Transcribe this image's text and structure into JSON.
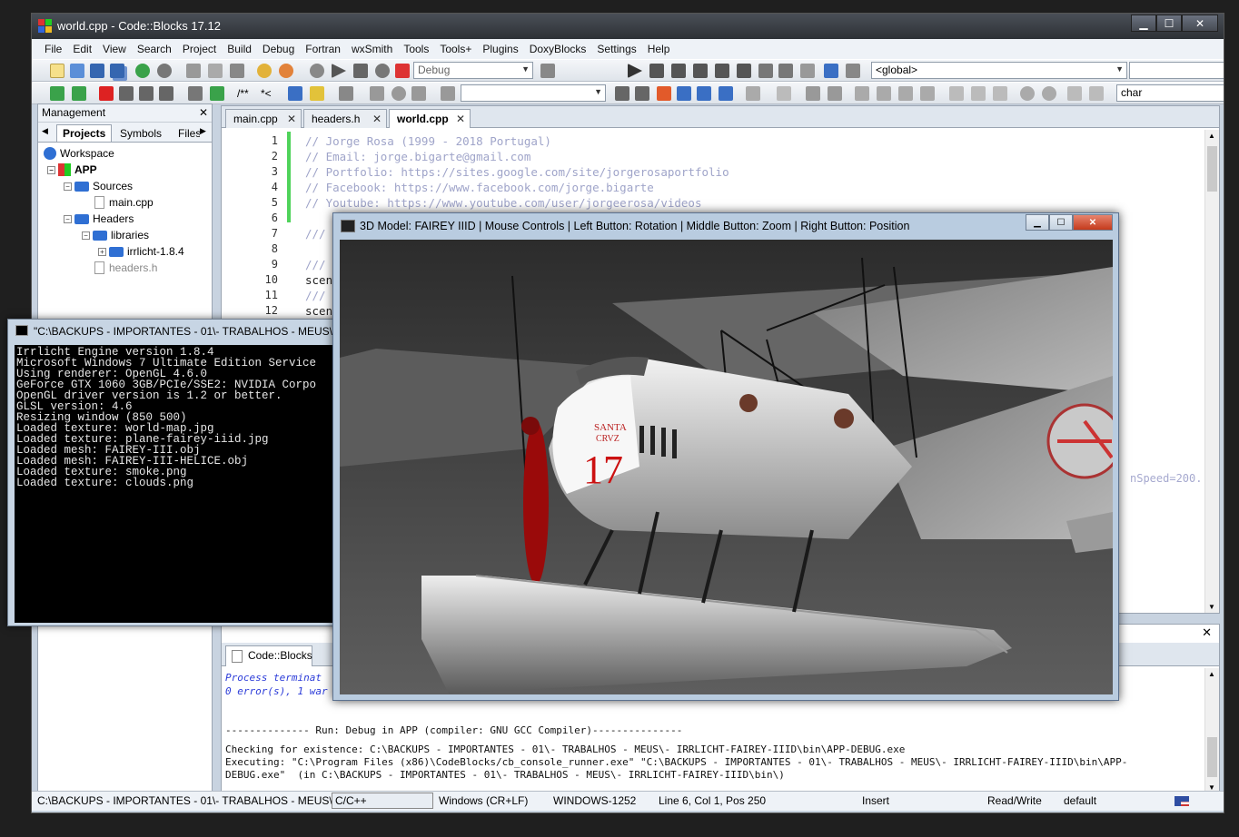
{
  "window": {
    "title": "world.cpp - Code::Blocks 17.12",
    "buttons": {
      "min": "▁",
      "max": "☐",
      "close": "✕"
    }
  },
  "menu": [
    "File",
    "Edit",
    "View",
    "Search",
    "Project",
    "Build",
    "Debug",
    "Fortran",
    "wxSmith",
    "Tools",
    "Tools+",
    "Plugins",
    "DoxyBlocks",
    "Settings",
    "Help"
  ],
  "toolbar": {
    "build_target": "Debug",
    "scope": "<global>",
    "search_text": "char",
    "doxy_labels": [
      "/**",
      "*<"
    ]
  },
  "management": {
    "title": "Management",
    "tabs": [
      "Projects",
      "Symbols",
      "Files"
    ],
    "tree": {
      "workspace": "Workspace",
      "project": "APP",
      "sources": "Sources",
      "main": "main.cpp",
      "headers": "Headers",
      "libraries": "libraries",
      "irrlicht": "irrlicht-1.8.4",
      "headers_file": "headers.h"
    }
  },
  "editor": {
    "tabs": [
      "main.cpp",
      "headers.h",
      "world.cpp"
    ],
    "active_tab": "world.cpp",
    "lines": [
      "1",
      "2",
      "3",
      "4",
      "5",
      "6",
      "7",
      "8",
      "9",
      "10",
      "11",
      "12"
    ],
    "code": [
      "// Jorge Rosa (1999 - 2018 Portugal)",
      "// Email: jorge.bigarte@gmail.com",
      "// Portfolio: https://sites.google.com/site/jorgerosaportfolio",
      "// Facebook: https://www.facebook.com/jorge.bigarte",
      "// Youtube: https://www.youtube.com/user/jorgeerosa/videos",
      "",
      "///",
      "",
      "///",
      "scen",
      "///",
      "scen"
    ],
    "right_fragment": "nSpeed=200."
  },
  "log": {
    "tab": "Code::Blocks",
    "lines": [
      "Process terminat",
      "0 error(s), 1 war",
      "",
      "-------------- Run: Debug in APP (compiler: GNU GCC Compiler)---------------",
      "",
      "Checking for existence: C:\\BACKUPS - IMPORTANTES - 01\\- TRABALHOS - MEUS\\- IRRLICHT-FAIREY-IIID\\bin\\APP-DEBUG.exe",
      "Executing: \"C:\\Program Files (x86)\\CodeBlocks/cb_console_runner.exe\" \"C:\\BACKUPS - IMPORTANTES - 01\\- TRABALHOS - MEUS\\- IRRLICHT-FAIREY-IIID\\bin\\APP-",
      "DEBUG.exe\"  (in C:\\BACKUPS - IMPORTANTES - 01\\- TRABALHOS - MEUS\\- IRRLICHT-FAIREY-IIID\\bin\\)"
    ]
  },
  "status": {
    "path": "C:\\BACKUPS - IMPORTANTES - 01\\- TRABALHOS - MEUS\\- IR",
    "lang": "C/C++",
    "eol": "Windows (CR+LF)",
    "encoding": "WINDOWS-1252",
    "position": "Line 6, Col 1, Pos 250",
    "mode": "Insert",
    "access": "Read/Write",
    "profile": "default"
  },
  "console": {
    "title": "\"C:\\BACKUPS - IMPORTANTES - 01\\- TRABALHOS - MEUS\\- IRR",
    "lines": [
      "Irrlicht Engine version 1.8.4",
      "Microsoft Windows 7 Ultimate Edition Service",
      "Using renderer: OpenGL 4.6.0",
      "GeForce GTX 1060 3GB/PCIe/SSE2: NVIDIA Corpo",
      "OpenGL driver version is 1.2 or better.",
      "GLSL version: 4.6",
      "Resizing window (850 500)",
      "Loaded texture: world-map.jpg",
      "Loaded texture: plane-fairey-iiid.jpg",
      "Loaded mesh: FAIREY-III.obj",
      "Loaded mesh: FAIREY-III-HELICE.obj",
      "Loaded texture: smoke.png",
      "Loaded texture: clouds.png"
    ]
  },
  "irrlicht": {
    "title": "3D Model: FAIREY IIID | Mouse Controls | Left Button: Rotation | Middle Button: Zoom | Right Button: Position",
    "plane_text": {
      "name1": "SANTA",
      "name2": "CRVZ",
      "number": "17"
    }
  }
}
